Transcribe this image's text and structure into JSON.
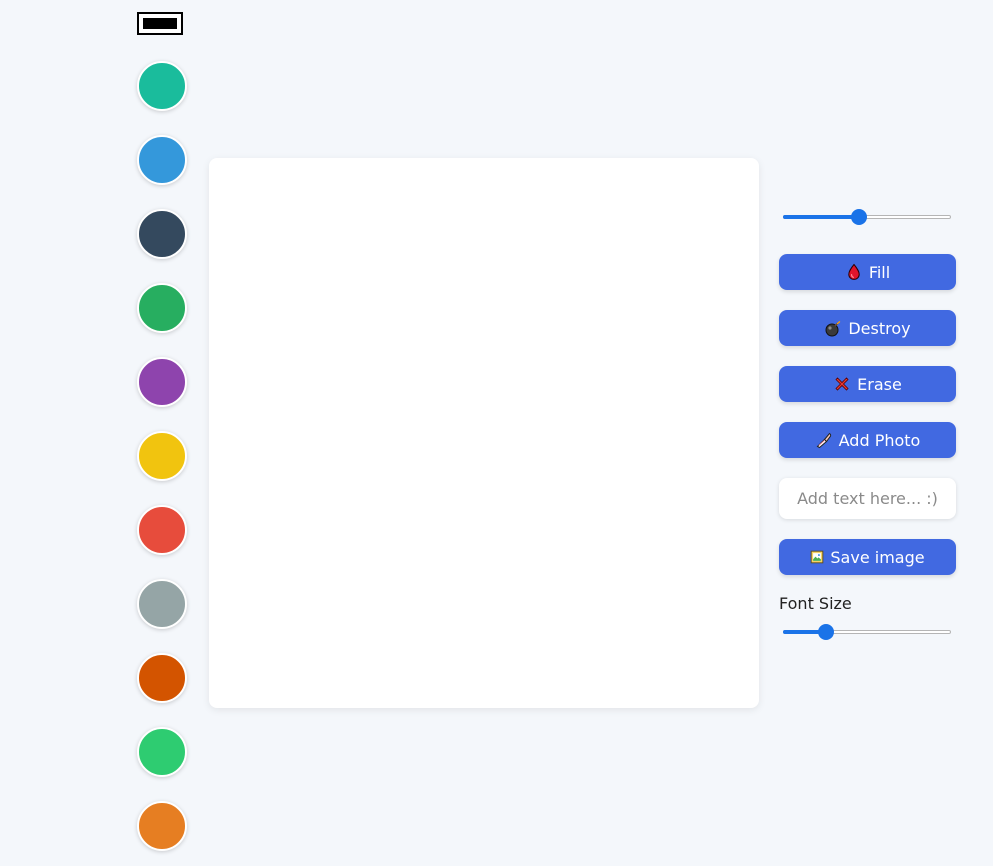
{
  "palette": {
    "current_color": "#000000",
    "colors": [
      "#1abc9c",
      "#3498db",
      "#34495e",
      "#27ae60",
      "#8e44ad",
      "#f1c40f",
      "#e74c3c",
      "#95a5a6",
      "#d35400",
      "#2ecc71",
      "#e67e22"
    ]
  },
  "controls": {
    "line_width_fraction": 0.45,
    "fill_label": "Fill",
    "destroy_label": "Destroy",
    "erase_label": "Erase",
    "add_photo_label": "Add Photo",
    "text_placeholder": "Add text here... :)",
    "save_label": "Save image",
    "font_size_label": "Font Size",
    "font_size_fraction": 0.24
  },
  "theme": {
    "accent": "#4169e1",
    "slider": "#1a73e8",
    "background": "#f4f7fb"
  }
}
